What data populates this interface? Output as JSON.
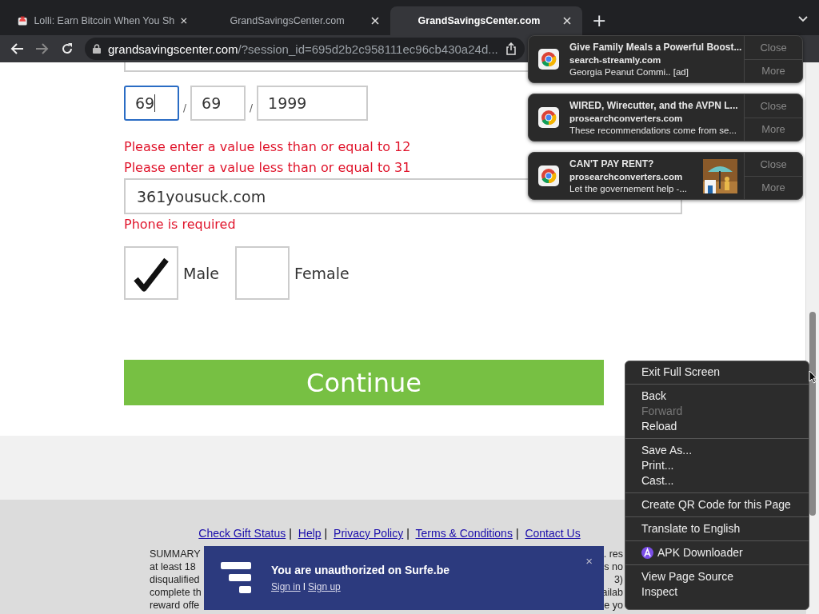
{
  "tabs": [
    {
      "title": "Lolli: Earn Bitcoin When You Sh",
      "selected": false
    },
    {
      "title": "GrandSavingsCenter.com",
      "selected": false
    },
    {
      "title": "GrandSavingsCenter.com",
      "selected": true
    }
  ],
  "new_tab": "+",
  "address": {
    "host": "grandsavingscenter.com",
    "path": "/?session_id=695d2b2c958111ec96cb430a24d..."
  },
  "form": {
    "date_fields": [
      {
        "value": "69",
        "focused": true
      },
      {
        "value": "69",
        "focused": false
      },
      {
        "value": "1999",
        "focused": false
      }
    ],
    "date_separator": "/",
    "errors_date": [
      "Please enter a value less than or equal to 12",
      "Please enter a value less than or equal to 31"
    ],
    "email_value": "361yousuck.com",
    "error_phone": "Phone is required",
    "genders": [
      {
        "label": "Male",
        "checked": true
      },
      {
        "label": "Female",
        "checked": false
      }
    ],
    "continue": "Continue"
  },
  "footer": {
    "separator": "|",
    "links": [
      "Check Gift Status",
      "Help",
      "Privacy Policy",
      "Terms & Conditions",
      "Contact Us"
    ],
    "summary_left": [
      "SUMMARY",
      "at least 18",
      "disqualified",
      "complete th",
      "reward offe"
    ],
    "summary_right": [
      ". res",
      "s no",
      "3)",
      "ailab",
      "e yo"
    ]
  },
  "notifications": [
    {
      "title": "Give Family Meals a Powerful Boost...",
      "source": "search-streamly.com",
      "body": "Georgia Peanut Commi.. [ad]",
      "close": "Close",
      "more": "More",
      "has_image": false
    },
    {
      "title": "WIRED, Wirecutter, and the AVPN L...",
      "source": "prosearchconverters.com",
      "body": "These recommendations come from se...",
      "close": "Close",
      "more": "More",
      "has_image": false
    },
    {
      "title": "CAN'T PAY RENT?",
      "source": "prosearchconverters.com",
      "body": "Let the governement help -...",
      "close": "Close",
      "more": "More",
      "has_image": true
    }
  ],
  "context_menu": [
    [
      {
        "label": "Exit Full Screen",
        "disabled": false
      }
    ],
    [
      {
        "label": "Back",
        "disabled": false
      },
      {
        "label": "Forward",
        "disabled": true
      },
      {
        "label": "Reload",
        "disabled": false
      }
    ],
    [
      {
        "label": "Save As...",
        "disabled": false
      },
      {
        "label": "Print...",
        "disabled": false
      },
      {
        "label": "Cast...",
        "disabled": false
      }
    ],
    [
      {
        "label": "Create QR Code for this Page",
        "disabled": false
      }
    ],
    [
      {
        "label": "Translate to English",
        "disabled": false
      }
    ],
    [
      {
        "label": "APK Downloader",
        "disabled": false,
        "kind": "extension"
      }
    ],
    [
      {
        "label": "View Page Source",
        "disabled": false
      },
      {
        "label": "Inspect",
        "disabled": false
      }
    ]
  ],
  "banner": {
    "title": "You are unauthorized on Surfe.be",
    "sign_in": "Sign in",
    "separator": "I",
    "sign_up": "Sign up",
    "close": "×"
  }
}
